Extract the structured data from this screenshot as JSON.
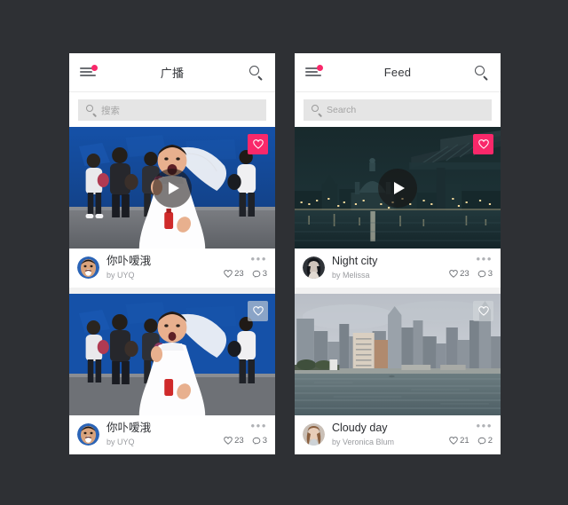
{
  "background_color": "#2e3034",
  "accent_color": "#f9286a",
  "phones": [
    {
      "id": "left",
      "locale": "zh",
      "header": {
        "title": "广播",
        "menu_icon": "hamburger-menu-icon",
        "menu_badge": true,
        "search_icon": "search-icon"
      },
      "search": {
        "placeholder": "搜索",
        "value": "",
        "icon": "search-icon"
      },
      "cards": [
        {
          "title": "你卟嗳涐",
          "author": "by UYQ",
          "likes": "23",
          "comments": "3",
          "favorited": true,
          "fav_icon": "heart-icon",
          "has_video": true,
          "play_icon": "play-icon",
          "more_icon": "more-options-icon",
          "like_icon": "heart-icon",
          "comment_icon": "comment-icon",
          "avatar": "avatar-uyq",
          "image": "bride-blue-wall-photo"
        },
        {
          "title": "你卟嗳涐",
          "author": "by UYQ",
          "likes": "23",
          "comments": "3",
          "favorited": false,
          "fav_icon": "heart-icon",
          "has_video": false,
          "play_icon": "play-icon",
          "more_icon": "more-options-icon",
          "like_icon": "heart-icon",
          "comment_icon": "comment-icon",
          "avatar": "avatar-uyq",
          "image": "bride-blue-wall-photo"
        }
      ]
    },
    {
      "id": "right",
      "locale": "en",
      "header": {
        "title": "Feed",
        "menu_icon": "hamburger-menu-icon",
        "menu_badge": true,
        "search_icon": "search-icon"
      },
      "search": {
        "placeholder": "Search",
        "value": "",
        "icon": "search-icon"
      },
      "cards": [
        {
          "title": "Night city",
          "author": "by Melissa",
          "likes": "23",
          "comments": "3",
          "favorited": true,
          "fav_icon": "heart-icon",
          "has_video": true,
          "play_icon": "play-icon",
          "more_icon": "more-options-icon",
          "like_icon": "heart-icon",
          "comment_icon": "comment-icon",
          "avatar": "avatar-melissa",
          "image": "night-city-river-photo"
        },
        {
          "title": "Cloudy day",
          "author": "by Veronica Blum",
          "likes": "21",
          "comments": "2",
          "favorited": false,
          "fav_icon": "heart-icon",
          "has_video": false,
          "play_icon": "play-icon",
          "more_icon": "more-options-icon",
          "like_icon": "heart-icon",
          "comment_icon": "comment-icon",
          "avatar": "avatar-veronica",
          "image": "cloudy-day-harbour-photo"
        }
      ]
    }
  ]
}
